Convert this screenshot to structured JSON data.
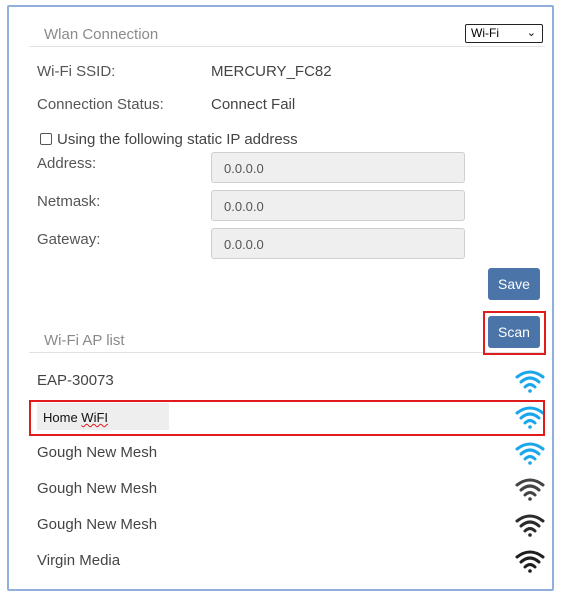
{
  "wlan": {
    "header": "Wlan Connection",
    "mode_select": "Wi-Fi",
    "ssid_label": "Wi-Fi SSID:",
    "ssid_value": "MERCURY_FC82",
    "status_label": "Connection Status:",
    "status_value": "Connect Fail",
    "static_ip_label": "Using the following static IP address",
    "static_ip_checked": false,
    "address_label": "Address:",
    "address_value": "0.0.0.0",
    "netmask_label": "Netmask:",
    "netmask_value": "0.0.0.0",
    "gateway_label": "Gateway:",
    "gateway_value": "0.0.0.0",
    "save_label": "Save"
  },
  "ap_list": {
    "header": "Wi-Fi AP list",
    "scan_label": "Scan",
    "entry_home_prefix": "Home ",
    "entry_home_suffix": "WiFI",
    "items": [
      {
        "name": "EAP-30073",
        "signal": "strong",
        "color": "#1aa7ea"
      },
      {
        "name": "Home WiFI",
        "signal": "strong",
        "color": "#1aa7ea"
      },
      {
        "name": "Gough New Mesh",
        "signal": "strong",
        "color": "#1aa7ea"
      },
      {
        "name": "Gough New Mesh",
        "signal": "medium",
        "color": "#444444"
      },
      {
        "name": "Gough New Mesh",
        "signal": "medium",
        "color": "#2b2b2b"
      },
      {
        "name": "Virgin Media",
        "signal": "medium",
        "color": "#1f1f1f"
      }
    ]
  },
  "colors": {
    "frame_border": "#8fb0dd",
    "button_bg": "#4b74a8",
    "highlight_red": "#e01b1b",
    "wifi_blue": "#1aa7ea"
  }
}
